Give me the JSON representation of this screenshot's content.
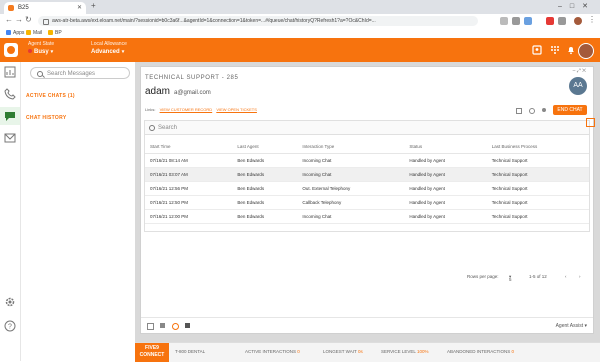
{
  "browser": {
    "tab_title": "B25",
    "url": "aws-atr-beta.aws/ext.eloam.net/main/?sessionid=b0c3a6f...&agentId=1&connection=1&token=...#/queue/chat/historyQ?Refresh1?a=?Oc&ChId=...",
    "bookmarks": [
      "Apps",
      "Mail",
      "BP"
    ]
  },
  "topbar": {
    "agent_state_label": "Agent State",
    "agent_state_value": "Busy",
    "allowance_label": "Local Allowance",
    "allowance_value": "Advanced"
  },
  "side": {
    "search_placeholder": "Search Messages",
    "active_chats": "ACTIVE CHATS (1)",
    "chat_history": "CHAT HISTORY"
  },
  "card": {
    "title": "TECHNICAL SUPPORT - 285",
    "name": "adam",
    "email": "a@gmail.com",
    "avatar_initials": "AA",
    "links_label": "Links:",
    "links": [
      "VIEW CUSTOMER RECORD",
      "VIEW OPEN TICKETS"
    ],
    "end_chat": "END CHAT",
    "search_placeholder": "Search",
    "columns": [
      "Start Time",
      "Last Agent",
      "Interaction Type",
      "Status",
      "Last Business Process"
    ],
    "rows": [
      [
        "07/16/21 08:14 AM",
        "Ben Edwards",
        "Incoming Chat",
        "Handled by Agent",
        "Technical Support"
      ],
      [
        "07/16/21 03:07 AM",
        "Ben Edwards",
        "Incoming Chat",
        "Handled by Agent",
        "Technical Support"
      ],
      [
        "07/16/21 12:56 PM",
        "Ben Edwards",
        "Out. External Telephony",
        "Handled by Agent",
        "Technical Support"
      ],
      [
        "07/16/21 12:50 PM",
        "Ben Edwards",
        "Callback Telephony",
        "Handled by Agent",
        "Technical Support"
      ],
      [
        "07/16/21 12:00 PM",
        "Ben Edwards",
        "Incoming Chat",
        "Handled by Agent",
        "Technical Support"
      ]
    ],
    "rows_per_page_label": "Rows per page:",
    "rows_per_page": "5",
    "range": "1-5 of 12",
    "agent_assist": "Agent Assist"
  },
  "bottombar": {
    "brand_line1": "FIVE9",
    "brand_line2": "CONNECT",
    "items": [
      {
        "label": "T-800 DENTAL",
        "value": ""
      },
      {
        "label": "ACTIVE INTERACTIONS",
        "value": "0"
      },
      {
        "label": "LONGEST WAIT",
        "value": "0s"
      },
      {
        "label": "SERVICE LEVEL",
        "value": "100%"
      },
      {
        "label": "ABANDONED INTERACTIONS",
        "value": "0"
      }
    ]
  },
  "colors": {
    "accent": "#f7730e",
    "rail_active": "#2e7d32",
    "avatar": "#5b7891"
  }
}
